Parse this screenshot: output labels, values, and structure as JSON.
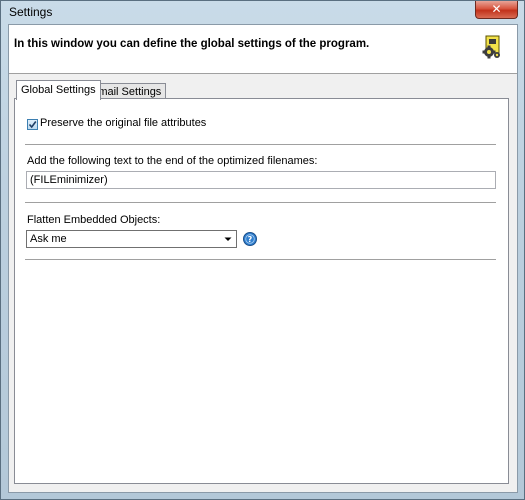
{
  "window": {
    "title": "Settings",
    "close_label": "✕"
  },
  "header": {
    "description": "In this window you can define the global settings of the program.",
    "icon": "settings-gear-icon"
  },
  "tabs": [
    {
      "label": "Global Settings",
      "active": true
    },
    {
      "label": "Email Settings",
      "active": false
    }
  ],
  "global_settings": {
    "preserve_attributes": {
      "label": "Preserve the original file attributes",
      "checked": true
    },
    "filename_suffix": {
      "label": "Add the following text to the end of the optimized filenames:",
      "value": "(FILEminimizer)"
    },
    "flatten_objects": {
      "label": "Flatten Embedded Objects:",
      "selected": "Ask me"
    },
    "help_icon": "help-icon"
  },
  "colors": {
    "accent": "#3c7fb1",
    "close_button": "#c2321b",
    "help_icon": "#2f7fd0"
  }
}
